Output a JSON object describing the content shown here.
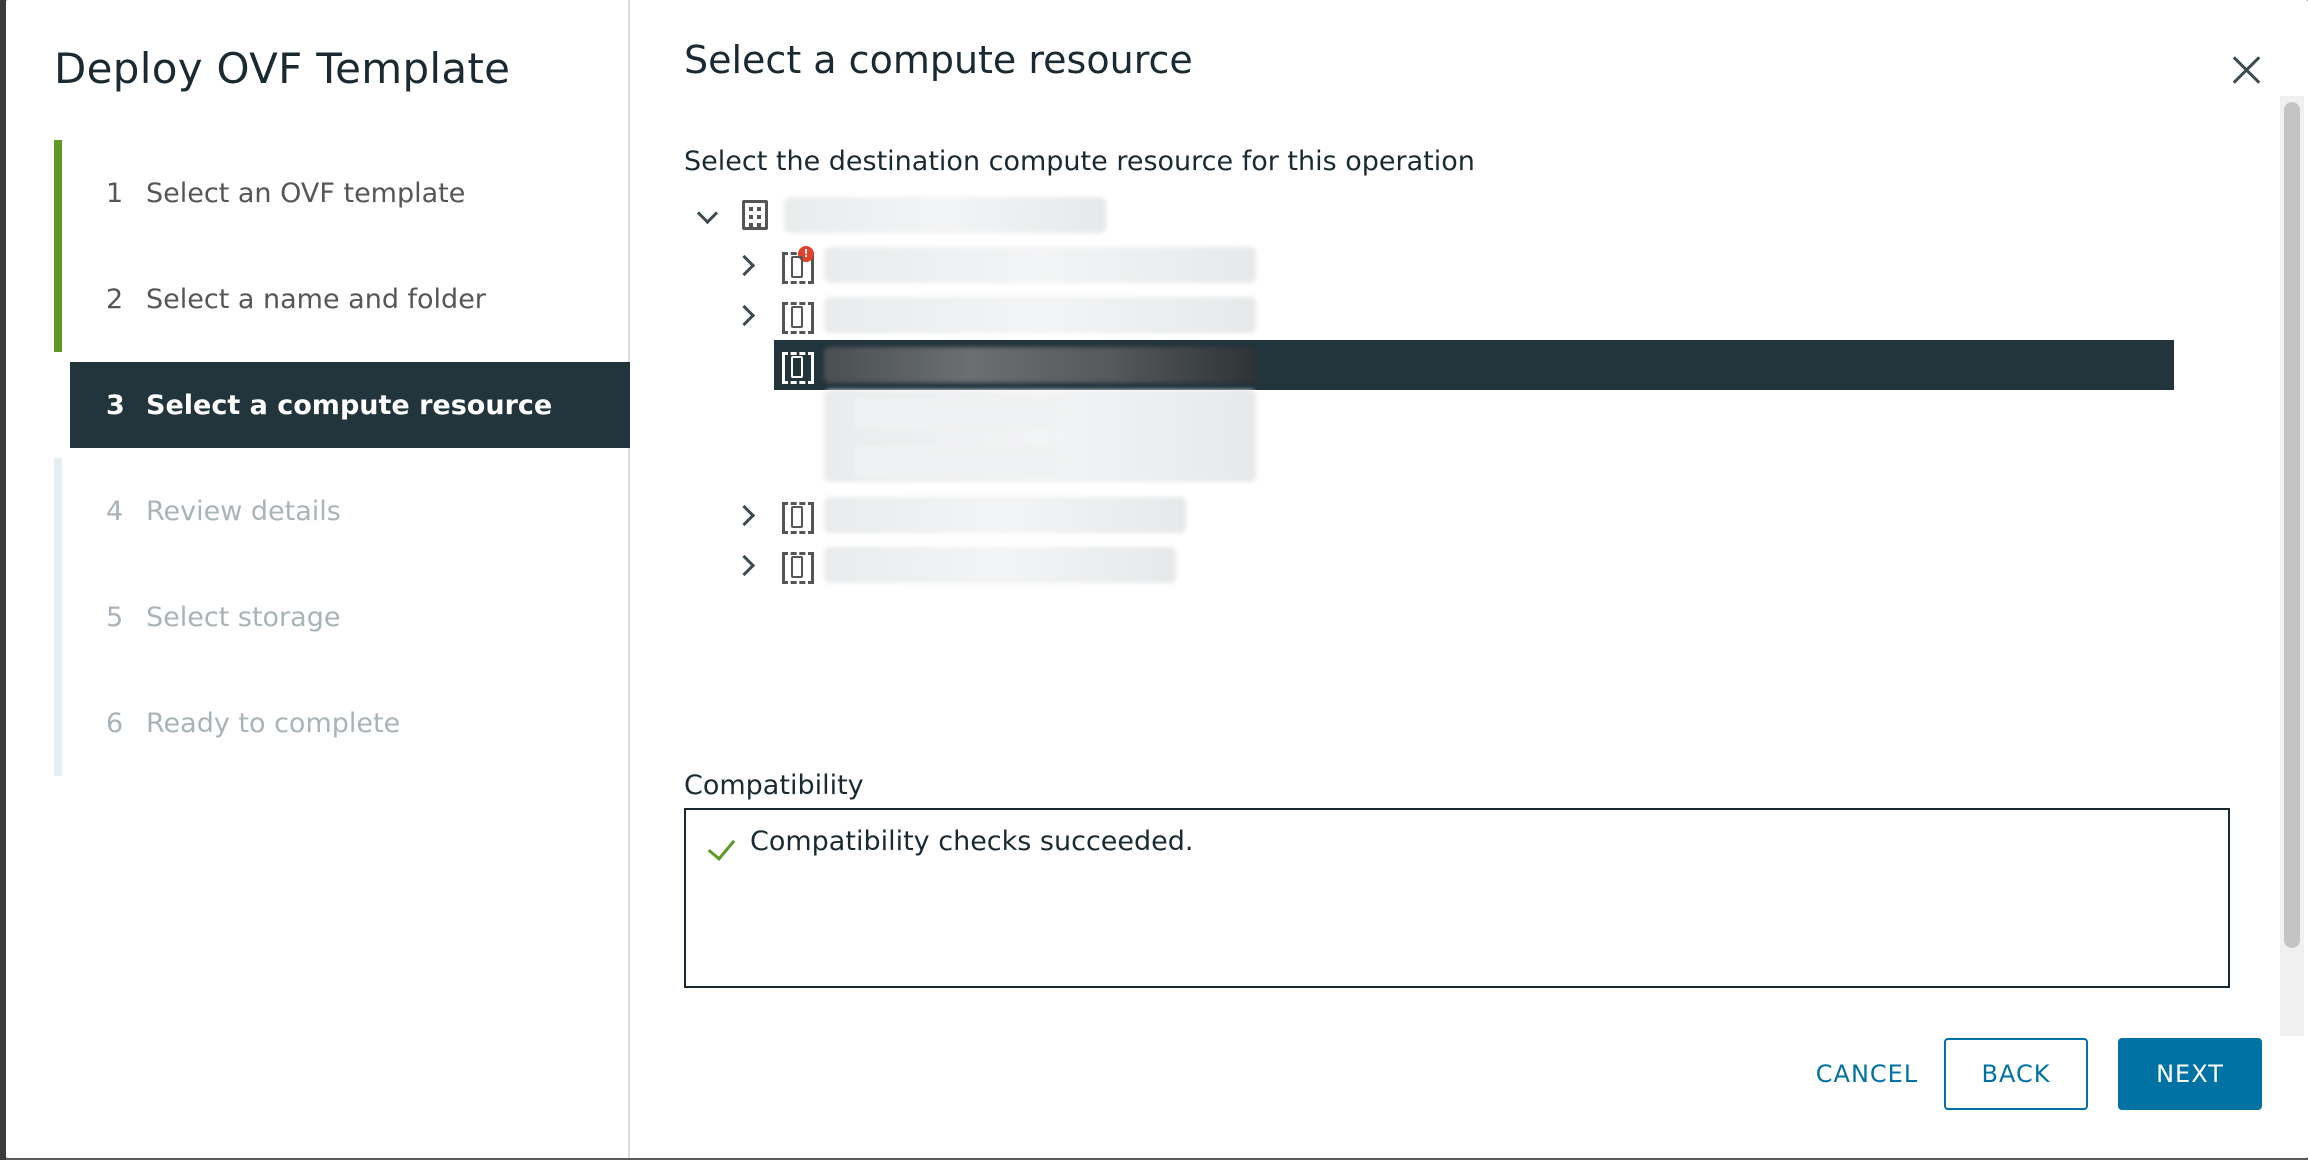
{
  "wizard": {
    "title": "Deploy OVF Template",
    "steps": [
      {
        "num": "1",
        "label": "Select an OVF template",
        "state": "done"
      },
      {
        "num": "2",
        "label": "Select a name and folder",
        "state": "done"
      },
      {
        "num": "3",
        "label": "Select a compute resource",
        "state": "active"
      },
      {
        "num": "4",
        "label": "Review details",
        "state": "future"
      },
      {
        "num": "5",
        "label": "Select storage",
        "state": "future"
      },
      {
        "num": "6",
        "label": "Ready to complete",
        "state": "future"
      }
    ]
  },
  "page": {
    "title": "Select a compute resource",
    "instructions": "Select the destination compute resource for this operation"
  },
  "compatibility": {
    "label": "Compatibility",
    "message": "Compatibility checks succeeded."
  },
  "buttons": {
    "cancel": "CANCEL",
    "back": "BACK",
    "next": "NEXT"
  },
  "colors": {
    "accent": "#0072a3",
    "selected_bg": "#22343c",
    "success": "#5c9a24",
    "alert": "#e2412c"
  }
}
